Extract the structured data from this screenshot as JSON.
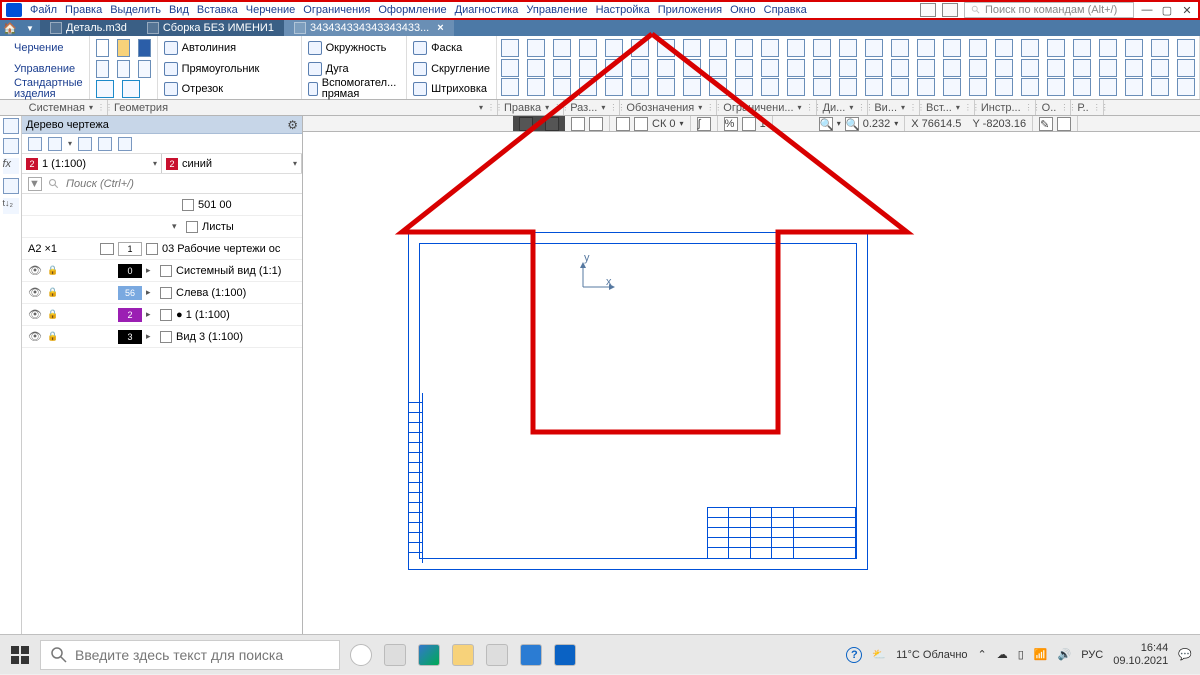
{
  "menu": {
    "items": [
      "Файл",
      "Правка",
      "Выделить",
      "Вид",
      "Вставка",
      "Черчение",
      "Ограничения",
      "Оформление",
      "Диагностика",
      "Управление",
      "Настройка",
      "Приложения",
      "Окно",
      "Справка"
    ],
    "search_placeholder": "Поиск по командам (Alt+/)"
  },
  "tabs": {
    "detail": "Деталь.m3d",
    "assembly": "Сборка БЕЗ ИМЕНИ1",
    "drawing": "343434334343343433..."
  },
  "ribbon": {
    "left": {
      "a": "Черчение",
      "b": "Управление",
      "c": "Стандартные изделия",
      "sys": "Системная"
    },
    "geom": {
      "auto": "Автолиния",
      "rect": "Прямоугольник",
      "seg": "Отрезок",
      "circle": "Окружность",
      "arc": "Дуга",
      "aux": "Вспомогател... прямая",
      "chamfer": "Фаска",
      "fillet": "Скругление",
      "hatch": "Штриховка",
      "title": "Геометрия"
    },
    "groups": [
      "Правка",
      "Раз...",
      "Обозначения",
      "Ограничени...",
      "Ди...",
      "Ви...",
      "Вст...",
      "Инстр...",
      "О..",
      "Р.."
    ]
  },
  "ctx": {
    "sk": "СК 0",
    "one": "1",
    "zoom": "0.232",
    "x": "X 76614.5",
    "y": "Y -8203.16"
  },
  "tree": {
    "title": "Дерево чертежа",
    "filter_placeholder": "Поиск (Ctrl+/)",
    "combo1": "1 (1:100)",
    "badge1": "2",
    "combo2": "синий",
    "badge2": "2",
    "doc": "501 00",
    "sheets": "Листы",
    "group": "03 Рабочие чертежи ос",
    "rows": [
      {
        "a": "A2  ×1",
        "n": "1",
        "label": "03 Рабочие чертежи ос",
        "color": "#fff",
        "fg": "#000",
        "icon": "sheet"
      },
      {
        "a": "",
        "n": "0",
        "label": "Системный вид (1:1)",
        "color": "#000",
        "fg": "#fff"
      },
      {
        "a": "",
        "n": "56",
        "label": "Слева (1:100)",
        "color": "#7aa9e0",
        "fg": "#fff"
      },
      {
        "a": "",
        "n": "2",
        "label": "● 1 (1:100)",
        "color": "#9b1fb3",
        "fg": "#fff"
      },
      {
        "a": "",
        "n": "3",
        "label": "Вид 3 (1:100)",
        "color": "#000",
        "fg": "#fff"
      }
    ]
  },
  "taskbar": {
    "search": "Введите здесь текст для поиска",
    "weather": "11°C Облачно",
    "lang": "РУС",
    "time": "16:44",
    "date": "09.10.2021"
  }
}
